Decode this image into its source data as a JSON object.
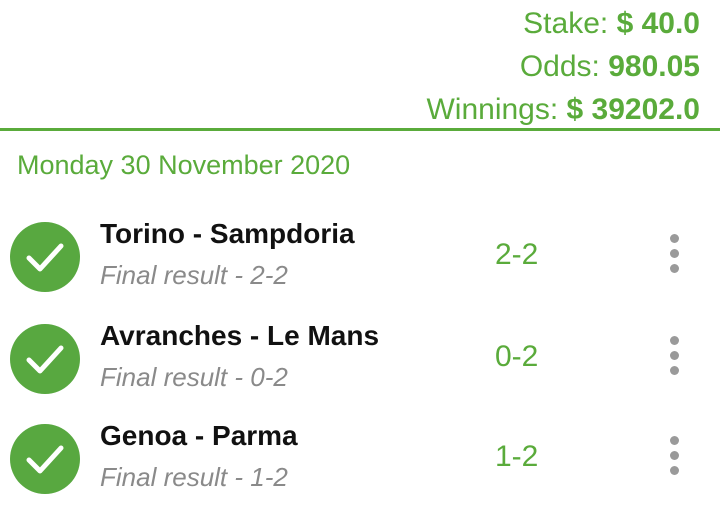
{
  "summary": {
    "stake_label": "Stake:",
    "stake_value": "$ 40.0",
    "odds_label": "Odds:",
    "odds_value": "980.05",
    "winnings_label": "Winnings:",
    "winnings_value": "$ 39202.0"
  },
  "date": "Monday 30 November 2020",
  "matches": [
    {
      "teams": "Torino - Sampdoria",
      "result": "Final result - 2-2",
      "score": "2-2",
      "status_icon": "check-icon"
    },
    {
      "teams": "Avranches - Le Mans",
      "result": "Final result - 0-2",
      "score": "0-2",
      "status_icon": "check-icon"
    },
    {
      "teams": "Genoa - Parma",
      "result": "Final result - 1-2",
      "score": "1-2",
      "status_icon": "check-icon"
    }
  ],
  "colors": {
    "accent": "#5aab3b",
    "check_bg": "#58a840",
    "secondary_text": "#8a8a8a",
    "menu_dots": "#9a9a9a"
  }
}
